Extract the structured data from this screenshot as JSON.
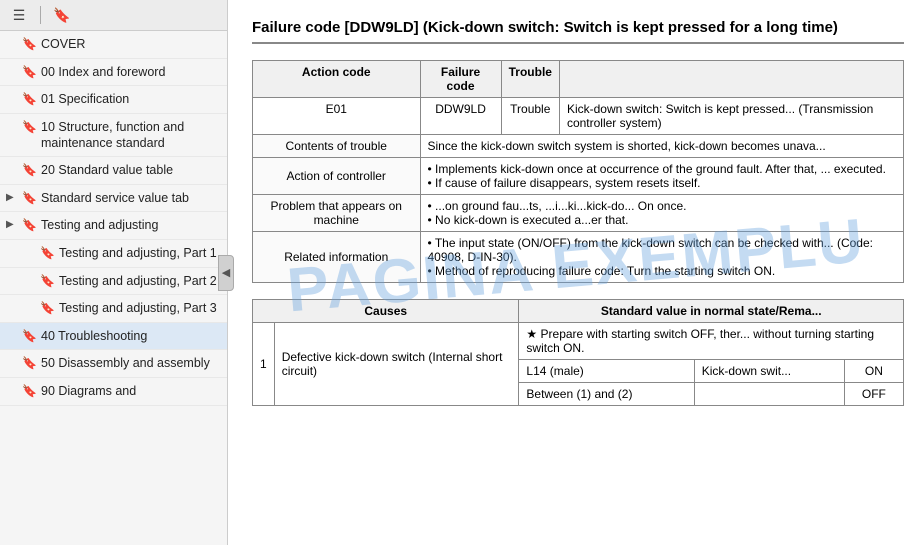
{
  "sidebar": {
    "toolbar": {
      "icon1": "☰",
      "icon2": "🔖"
    },
    "items": [
      {
        "id": "cover",
        "label": "COVER",
        "hasChevron": false,
        "indent": 0
      },
      {
        "id": "index",
        "label": "00 Index and foreword",
        "hasChevron": false,
        "indent": 0
      },
      {
        "id": "spec",
        "label": "01 Specification",
        "hasChevron": false,
        "indent": 0
      },
      {
        "id": "structure",
        "label": "10 Structure, function and maintenance standard",
        "hasChevron": false,
        "indent": 0
      },
      {
        "id": "standard",
        "label": "20 Standard value table",
        "hasChevron": false,
        "indent": 0
      },
      {
        "id": "service",
        "label": "Standard service value tab",
        "hasChevron": true,
        "indent": 0,
        "expanded": false
      },
      {
        "id": "testing1",
        "label": "Testing and adjusting",
        "hasChevron": true,
        "indent": 0,
        "expanded": false
      },
      {
        "id": "testing2",
        "label": "Testing and adjusting, Part 1",
        "hasChevron": false,
        "indent": 1
      },
      {
        "id": "testing3",
        "label": "Testing and adjusting, Part 2",
        "hasChevron": false,
        "indent": 1
      },
      {
        "id": "testing4",
        "label": "Testing and adjusting, Part 3",
        "hasChevron": false,
        "indent": 1
      },
      {
        "id": "trouble",
        "label": "40 Troubleshooting",
        "hasChevron": false,
        "indent": 0,
        "active": true
      },
      {
        "id": "disassembly",
        "label": "50 Disassembly and assembly",
        "hasChevron": false,
        "indent": 0
      },
      {
        "id": "diagrams",
        "label": "90 Diagrams and",
        "hasChevron": false,
        "indent": 0
      }
    ]
  },
  "main": {
    "title": "Failure code [DDW9LD] (Kick-down switch: Switch is kept pressed for a long time)",
    "title_short": "Failure code [DDW9LD] (Kick-down switch: Switch is ke...",
    "info_table": {
      "headers": [
        "Action code",
        "Failure code",
        "Trouble"
      ],
      "action_code": "E01",
      "failure_code": "DDW9LD",
      "trouble_label": "Trouble",
      "trouble_desc": "Kick-down switch: Switch is kept pressed... (Transmission controller system)",
      "rows": [
        {
          "label": "Contents of trouble",
          "content": "Since the kick-down switch system is shorted, kick-down becomes unava..."
        },
        {
          "label": "Action of controller",
          "content": "• Implements kick-down once at occurrence of the ground fault. After that, ... executed.\n• If cause of failure disappears, system resets itself."
        },
        {
          "label": "Problem that appears on machine",
          "content": "• ...on ground fau...ts, ...i...ki...kick-do... On once.\n• No kick-down is executed a...er that."
        },
        {
          "label": "Related information",
          "content": "• The input state (ON/OFF) from the kick-down switch can be checked with... (Code: 40908, D-IN-30).\n• Method of reproducing failure code: Turn the starting switch ON."
        }
      ]
    },
    "causes_table": {
      "headers": [
        "Causes",
        "Standard value in normal state/Rema..."
      ],
      "rows": [
        {
          "num": "1",
          "cause": "Defective kick-down switch (Internal short circuit)",
          "std_note": "★ Prepare with starting switch OFF, ther... without turning starting switch ON.",
          "sub_rows": [
            {
              "connector": "L14 (male)",
              "measure": "Kick-down swit...",
              "condition": "ON",
              "value": ""
            },
            {
              "connector": "Between (1) and (2)",
              "measure": "",
              "condition": "OFF",
              "value": ""
            }
          ]
        }
      ]
    },
    "watermark": "PAGINA EXEMPLU"
  }
}
